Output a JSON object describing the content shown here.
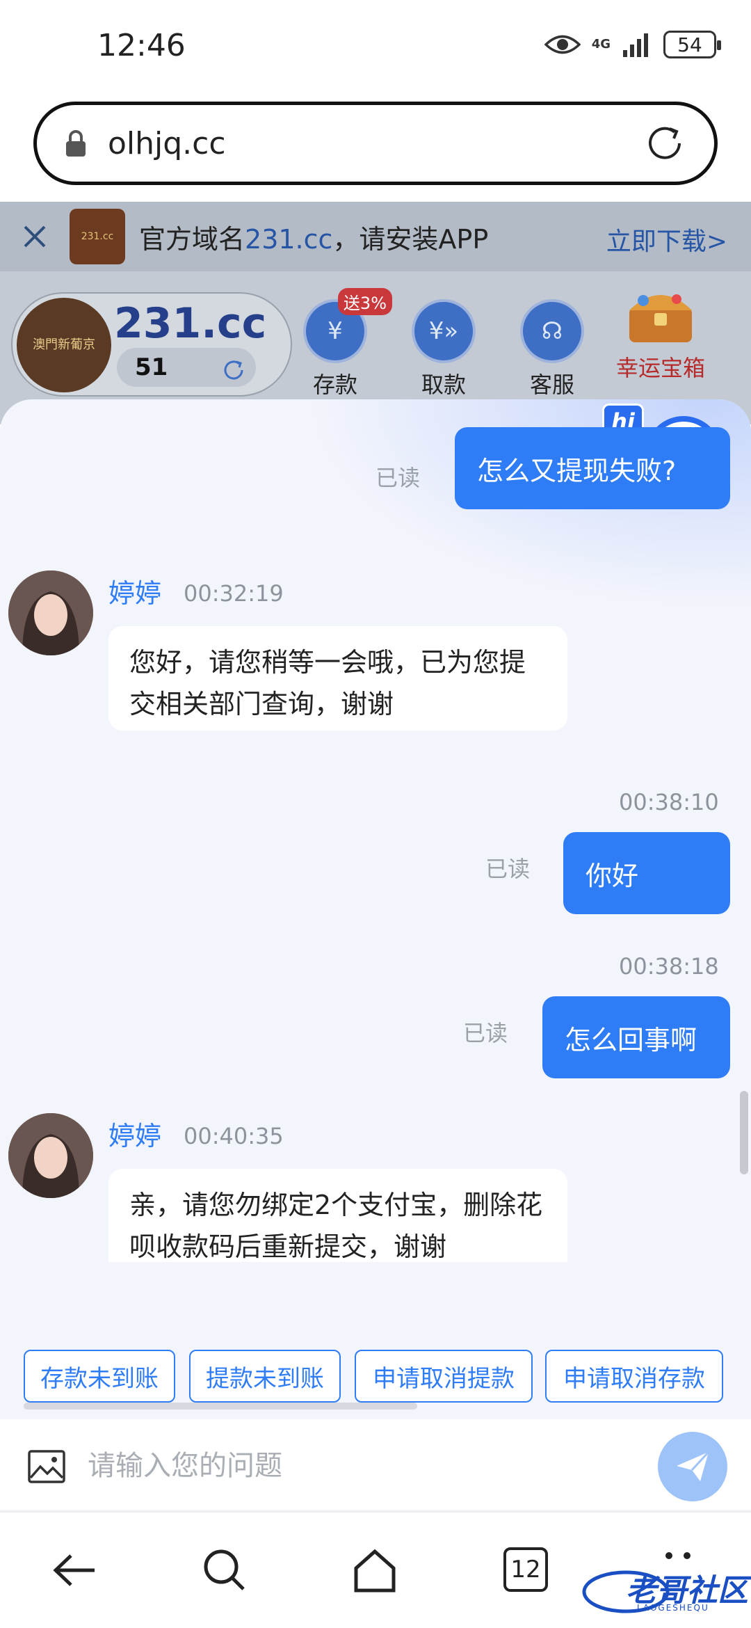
{
  "status_bar": {
    "time": "12:46",
    "network": "4G",
    "battery": "54"
  },
  "address_bar": {
    "url": "olhjq.cc"
  },
  "site": {
    "banner": {
      "text_prefix": "官方域名",
      "domain": "231.cc",
      "text_suffix": "，请安装APP",
      "download": "立即下载>"
    },
    "logo_text": "澳門新葡京",
    "logo_domain": "231.cc",
    "domain": "231.cc",
    "balance": "51",
    "actions": [
      {
        "label": "存款",
        "badge": "送3%"
      },
      {
        "label": "取款"
      },
      {
        "label": "客服"
      }
    ],
    "treasure": {
      "label": "幸运宝箱"
    }
  },
  "chat": {
    "agent_hi": "hi",
    "messages": [
      {
        "type": "out",
        "text": "怎么又提现失败?",
        "status": "已读"
      },
      {
        "type": "in",
        "sender": "婷婷",
        "time": "00:32:19",
        "text": "您好，请您稍等一会哦，已为您提交相关部门查询，谢谢"
      },
      {
        "type": "out",
        "time": "00:38:10",
        "text": "你好",
        "status": "已读"
      },
      {
        "type": "out",
        "time": "00:38:18",
        "text": "怎么回事啊",
        "status": "已读"
      },
      {
        "type": "in",
        "sender": "婷婷",
        "time": "00:40:35",
        "text": "亲，请您勿绑定2个支付宝，删除花呗收款码后重新提交，谢谢"
      }
    ],
    "quick_replies": [
      "存款未到账",
      "提款未到账",
      "申请取消提款",
      "申请取消存款"
    ],
    "input_placeholder": "请输入您的问题"
  },
  "nav": {
    "tab_count": "12"
  },
  "watermark": {
    "text": "老哥社区",
    "sub": "LAOGESHEQU"
  },
  "colors": {
    "accent": "#2e7cf6",
    "agent_name": "#2e7cf6",
    "read": "#9aa0a8"
  }
}
